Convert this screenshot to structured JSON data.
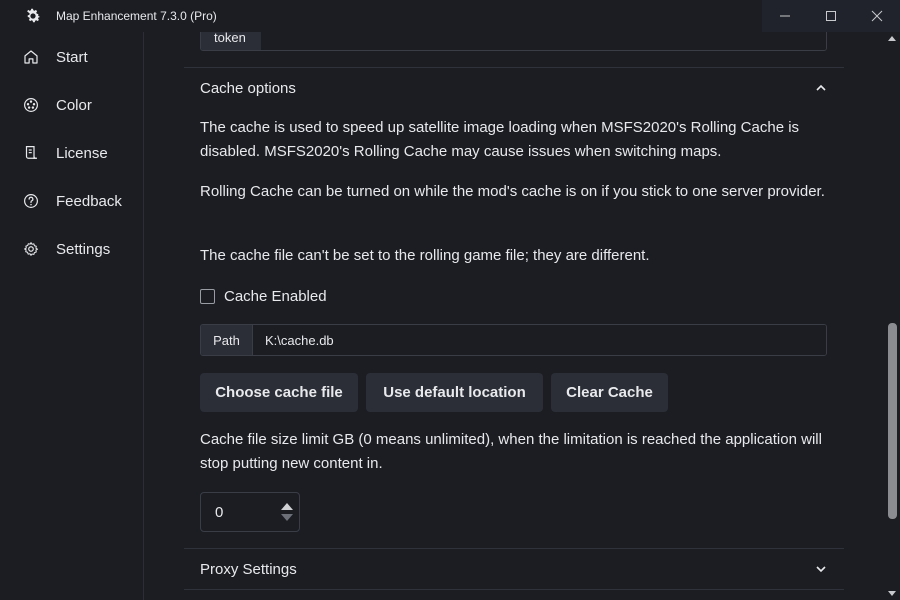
{
  "window": {
    "title": "Map Enhancement 7.3.0 (Pro)",
    "icon": "gear-icon",
    "controls": [
      "minimize-icon",
      "maximize-icon",
      "close-icon"
    ]
  },
  "sidebar": {
    "items": [
      {
        "label": "Start",
        "icon": "home-icon"
      },
      {
        "label": "Color",
        "icon": "palette-icon"
      },
      {
        "label": "License",
        "icon": "license-icon"
      },
      {
        "label": "Feedback",
        "icon": "help-circle-icon"
      },
      {
        "label": "Settings",
        "icon": "gear-icon"
      }
    ]
  },
  "token": {
    "label": "token",
    "value": ""
  },
  "cache_section": {
    "title": "Cache options",
    "expanded": true,
    "paragraph1": "The cache is used to speed up satellite image loading when MSFS2020's Rolling Cache is disabled. MSFS2020's Rolling Cache may cause issues when switching maps.",
    "paragraph2": "Rolling Cache can be turned on while the mod's cache is on if you stick to one server provider.",
    "paragraph3": "The cache file can't be set to the rolling game file; they are different.",
    "checkbox_label": "Cache Enabled",
    "checkbox_checked": false,
    "path_label": "Path",
    "path_value": "K:\\cache.db",
    "buttons": {
      "choose": "Choose cache file",
      "default": "Use default location",
      "clear": "Clear Cache"
    },
    "size_limit_text": "Cache file size limit GB (0 means unlimited), when the limitation is reached the application will stop putting new content in.",
    "size_limit_value": "0"
  },
  "proxy_section": {
    "title": "Proxy Settings",
    "expanded": false
  },
  "colors": {
    "background": "#1b1d23",
    "surface": "#2b2e36",
    "text": "#e8e9ec",
    "border": "#3a3d46"
  }
}
